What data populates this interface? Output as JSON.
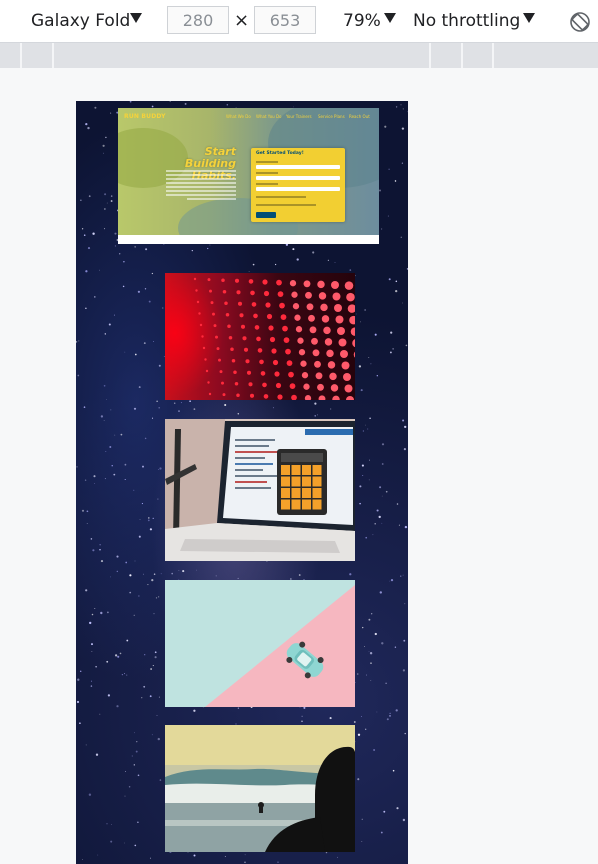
{
  "toolbar": {
    "device": "Galaxy Fold",
    "width": "280",
    "height": "653",
    "times": "×",
    "zoom": "79%",
    "throttling": "No throttling",
    "rotate_icon": "rotate-icon"
  },
  "hero": {
    "brand": "RUN BUDDY",
    "nav": [
      "What We Do",
      "What You Do",
      "Your Trainers",
      "Service Plans",
      "Reach Out"
    ],
    "title_line1": "Start Building",
    "title_line2": "Habits.",
    "form_title": "Get Started Today!"
  },
  "cards": [
    {
      "image": "red-led-wall-photo"
    },
    {
      "image": "laptop-calculator-photo"
    },
    {
      "image": "toy-car-pastel-photo"
    },
    {
      "image": "ocean-surfer-photo"
    }
  ],
  "colors": {
    "accent_yellow": "#f5d23a",
    "form_blue": "#024e76",
    "space_bg": "#0d1433"
  }
}
